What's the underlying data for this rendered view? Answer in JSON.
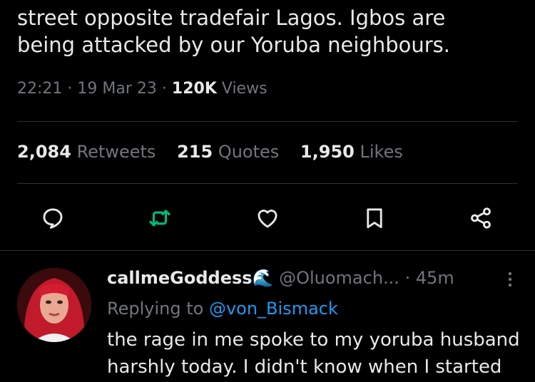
{
  "tweet": {
    "lines": [
      "street opposite tradefair Lagos. Igbos are",
      "being attacked by our Yoruba neighbours."
    ],
    "time": "22:21",
    "date": "19 Mar 23",
    "views_count": "120K",
    "views_label": "Views",
    "dot": "·"
  },
  "stats": {
    "retweets": {
      "count": "2,084",
      "label": "Retweets"
    },
    "quotes": {
      "count": "215",
      "label": "Quotes"
    },
    "likes": {
      "count": "1,950",
      "label": "Likes"
    }
  },
  "actions": [
    {
      "icon": "reply-icon"
    },
    {
      "icon": "retweet-icon",
      "color": "#00ba7c"
    },
    {
      "icon": "like-icon"
    },
    {
      "icon": "bookmark-icon"
    },
    {
      "icon": "share-icon"
    }
  ],
  "reply": {
    "name": "callmeGoddess",
    "emoji": "🌊",
    "handle": "@Oluomach...",
    "dot": "·",
    "time": "45m",
    "replying_to_label": "Replying to",
    "replying_to_handle": "@von_Bismack",
    "lines": [
      "the rage in me spoke to my yoruba husband",
      "harshly today. I didn't know when I started"
    ]
  },
  "colors": {
    "background": "#000000",
    "text": "#e7e9ea",
    "secondary": "#71767b",
    "accent": "#1d9bf0",
    "retweet_green": "#00ba7c",
    "divider": "#2f3336"
  }
}
